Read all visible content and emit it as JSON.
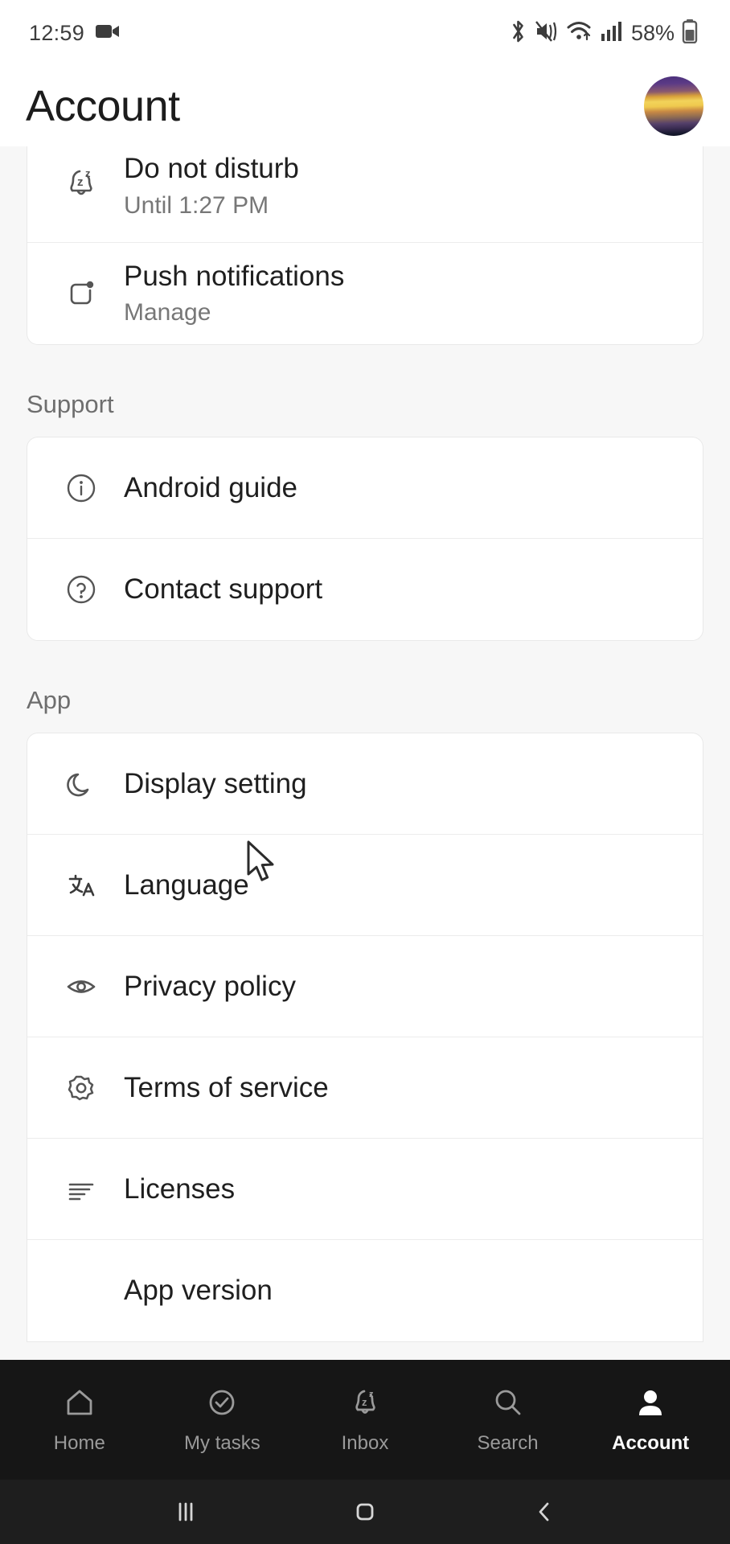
{
  "statusbar": {
    "time": "12:59",
    "battery_percent": "58%",
    "icons": [
      "video-recording-icon",
      "bluetooth-icon",
      "sound-mute-vibrate-icon",
      "wifi-icon",
      "cellular-signal-icon",
      "battery-icon"
    ]
  },
  "header": {
    "title": "Account",
    "avatar_name": "profile-avatar"
  },
  "sections": [
    {
      "label": "",
      "items": [
        {
          "icon": "bell-snooze-icon",
          "title": "Do not disturb",
          "subtitle": "Until 1:27 PM"
        },
        {
          "icon": "push-notification-icon",
          "title": "Push notifications",
          "subtitle": "Manage"
        }
      ]
    },
    {
      "label": "Support",
      "items": [
        {
          "icon": "info-circle-icon",
          "title": "Android guide",
          "subtitle": ""
        },
        {
          "icon": "question-circle-icon",
          "title": "Contact support",
          "subtitle": ""
        }
      ]
    },
    {
      "label": "App",
      "items": [
        {
          "icon": "moon-icon",
          "title": "Display setting",
          "subtitle": ""
        },
        {
          "icon": "translate-icon",
          "title": "Language",
          "subtitle": ""
        },
        {
          "icon": "eye-icon",
          "title": "Privacy policy",
          "subtitle": ""
        },
        {
          "icon": "gear-icon",
          "title": "Terms of service",
          "subtitle": ""
        },
        {
          "icon": "list-lines-icon",
          "title": "Licenses",
          "subtitle": ""
        },
        {
          "icon": "",
          "title": "App version",
          "subtitle": ""
        }
      ]
    }
  ],
  "bottom_nav": {
    "items": [
      {
        "icon": "home-icon",
        "label": "Home",
        "active": false
      },
      {
        "icon": "check-circle-icon",
        "label": "My tasks",
        "active": false
      },
      {
        "icon": "bell-snooze-icon",
        "label": "Inbox",
        "active": false
      },
      {
        "icon": "search-icon",
        "label": "Search",
        "active": false
      },
      {
        "icon": "person-icon",
        "label": "Account",
        "active": true
      }
    ]
  },
  "system_nav": {
    "items": [
      "recents-icon",
      "home-square-icon",
      "back-chevron-icon"
    ]
  },
  "colors": {
    "page_bg": "#f7f7f7",
    "card_bg": "#ffffff",
    "nav_bg": "#161616",
    "sysnav_bg": "#1e1e1e",
    "text_primary": "#1f1f1f",
    "text_secondary": "#777777",
    "nav_inactive": "#9a9a9a",
    "nav_active": "#ffffff"
  }
}
